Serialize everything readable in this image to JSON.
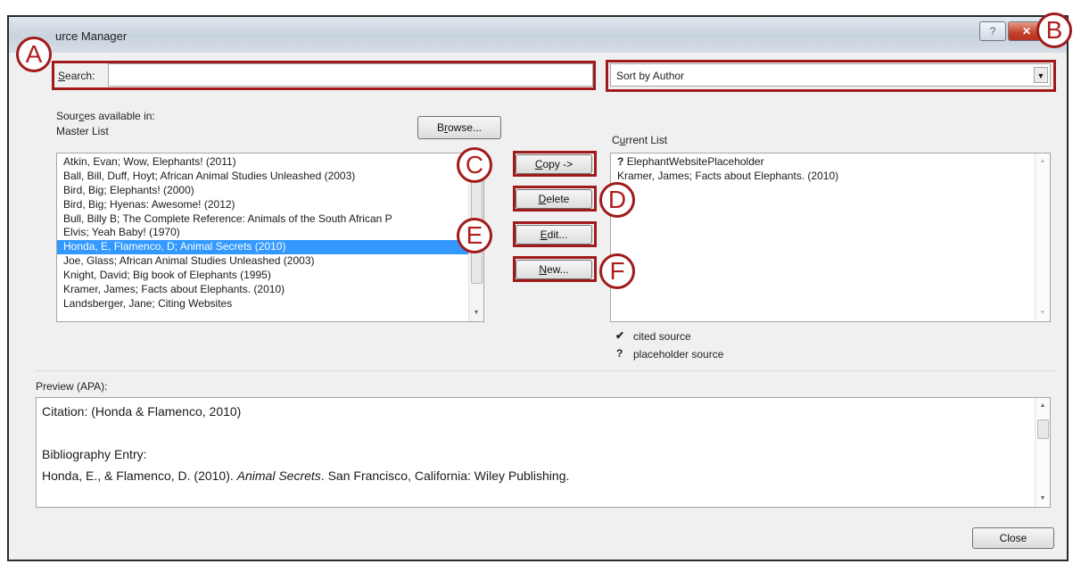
{
  "window": {
    "title": "urce Manager",
    "help_glyph": "?",
    "close_glyph": "✕"
  },
  "search": {
    "label_accel": "S",
    "label_rest": "earch:",
    "value": "",
    "placeholder": ""
  },
  "sort": {
    "selected": "Sort by Author",
    "arrow": "▼"
  },
  "sources_available": {
    "label_pre": "Sour",
    "label_accel": "c",
    "label_post": "es available in:",
    "master_label": "Master List",
    "browse_pre": "B",
    "browse_accel": "r",
    "browse_post": "owse..."
  },
  "master_list": {
    "items": [
      "Atkin, Evan; Wow, Elephants! (2011)",
      "Ball, Bill, Duff, Hoyt; African Animal Studies Unleashed (2003)",
      "Bird, Big; Elephants! (2000)",
      "Bird, Big; Hyenas: Awesome! (2012)",
      "Bull, Billy B; The Complete Reference: Animals of the South African P",
      "Elvis; Yeah Baby! (1970)",
      "Honda, E, Flamenco, D; Animal Secrets (2010)",
      "Joe, Glass; African Animal Studies Unleashed (2003)",
      "Knight, David; Big book of Elephants (1995)",
      "Kramer, James; Facts about Elephants. (2010)",
      "Landsberger, Jane; Citing Websites"
    ],
    "selected_index": 6
  },
  "actions": {
    "copy_accel": "C",
    "copy_rest": "opy ->",
    "delete_accel": "D",
    "delete_rest": "elete",
    "edit_accel": "E",
    "edit_rest": "dit...",
    "new_accel": "N",
    "new_rest": "ew..."
  },
  "current_list": {
    "label_pre": "C",
    "label_accel": "u",
    "label_post": "rrent List",
    "items": [
      {
        "marker": "?",
        "text": "ElephantWebsitePlaceholder"
      },
      {
        "marker": "",
        "text": "Kramer, James; Facts about Elephants. (2010)"
      }
    ]
  },
  "legend": {
    "cited_symbol": "✔",
    "cited_label": "cited source",
    "placeholder_symbol": "?",
    "placeholder_label": "placeholder source"
  },
  "preview": {
    "label": "Preview (APA):",
    "citation": "Citation:  (Honda & Flamenco, 2010)",
    "bib_heading": "Bibliography Entry:",
    "bib_before": "Honda, E., & Flamenco, D. (2010). ",
    "bib_title": "Animal Secrets",
    "bib_after": ". San Francisco, California: Wiley Publishing."
  },
  "footer": {
    "close_label": "Close"
  },
  "callouts": {
    "a": "A",
    "b": "B",
    "c": "C",
    "d": "D",
    "e": "E",
    "f": "F"
  },
  "colors": {
    "callout": "#a11a1a",
    "selection": "#3399ff"
  }
}
